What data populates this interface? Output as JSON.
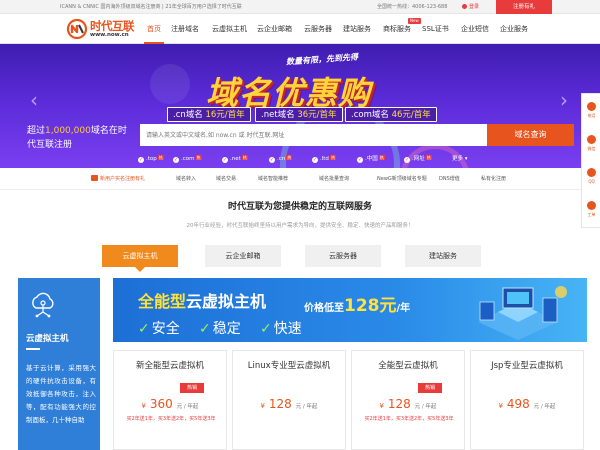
{
  "topbar": {
    "notice": "ICANN & CNNIC 国内海外顶级双域名注册商 | 21年全球百万用户选择了时代互联",
    "hotline": "全国统一热线：4006-123-688",
    "login": "登录",
    "register": "注册有礼"
  },
  "header": {
    "logo_name": "时代互联",
    "logo_url": "www.now.cn",
    "nav": [
      "首页",
      "注册域名",
      "云虚拟主机",
      "云企业邮箱",
      "云服务器",
      "建站服务",
      "商标服务",
      "SSL证书",
      "企业短信",
      "企业服务"
    ],
    "nav_badge": "New"
  },
  "banner": {
    "tagline": "数量有限，先到先得",
    "title": "域名优惠购",
    "prices": [
      {
        "tld": ".cn域名",
        "price": "16元/首年"
      },
      {
        "tld": ".net域名",
        "price": "36元/首年"
      },
      {
        "tld": ".com域名",
        "price": "46元/首年"
      }
    ]
  },
  "search": {
    "intro_prefix": "超过",
    "intro_number": "1,000,000",
    "intro_suffix": "域名在时代互联注册",
    "placeholder": "请输入英文或中文域名,如 now.cn 或 时代互联.网址",
    "button": "域名查询",
    "tlds": [
      {
        "label": ".top",
        "hot": "热"
      },
      {
        "label": ".com",
        "hot": "热"
      },
      {
        "label": ".net",
        "hot": "热"
      },
      {
        "label": ".cn",
        "hot": "热"
      },
      {
        "label": ".ltd",
        "hot": "热"
      },
      {
        "label": ".中国",
        "hot": "热"
      },
      {
        "label": ".网址",
        "hot": "热"
      }
    ],
    "more": "更多"
  },
  "quick_links": [
    "新用户实名注册有礼",
    "域名转入",
    "域名交易",
    "域名智能推荐",
    "域名批量查询",
    "NewG新顶级域名专题",
    "DNS增值",
    "私有化注册"
  ],
  "section": {
    "title": "时代互联为您提供稳定的互联网服务",
    "subtitle": "20年行业经验，时代互联始终坚持以用户需求为导向，提供安全、稳定、快速的产品和服务！"
  },
  "tabs": [
    "云虚拟主机",
    "云企业邮箱",
    "云服务器",
    "建站服务"
  ],
  "side_panel": {
    "icon": "cloud-network-icon",
    "title": "云虚拟主机",
    "desc": "基于云计算，采用强大的硬件抗攻击设备，有效抵御各种攻击，注入等，配有功能强大的控制面板，几十种自助"
  },
  "promo": {
    "title_bold": "全能型",
    "title_rest": "云虚拟主机",
    "price_prefix": "价格低至",
    "price_value": "128元",
    "price_suffix": "/年",
    "features": [
      "安全",
      "稳定",
      "快速"
    ]
  },
  "products": [
    {
      "name": "新全能型云虚拟机",
      "hot": "热销",
      "currency": "¥",
      "price": "360",
      "unit": "元 / 年起",
      "promo": "买2年送1年，买3年送2年，买5年送3年"
    },
    {
      "name": "Linux专业型云虚拟机",
      "hot": "",
      "currency": "¥",
      "price": "128",
      "unit": "元 / 年起",
      "promo": ""
    },
    {
      "name": "全能型云虚拟机",
      "hot": "热销",
      "currency": "¥",
      "price": "128",
      "unit": "元 / 年起",
      "promo": "买2年送1年，买3年送2年，买5年送3年"
    },
    {
      "name": "Jsp专业型云虚拟机",
      "hot": "",
      "currency": "¥",
      "price": "498",
      "unit": "元 / 年起",
      "promo": ""
    }
  ],
  "float_bar": [
    {
      "icon": "phone-icon",
      "label": "电话"
    },
    {
      "icon": "wechat-icon",
      "label": "微信"
    },
    {
      "icon": "qq-icon",
      "label": "QQ"
    },
    {
      "icon": "ticket-icon",
      "label": "工单"
    }
  ],
  "colors": {
    "accent": "#e8541e",
    "banner": "#5b2bd8",
    "panel": "#2f7fd8",
    "tab_active": "#f08a1c",
    "hot": "#e83c3c"
  }
}
